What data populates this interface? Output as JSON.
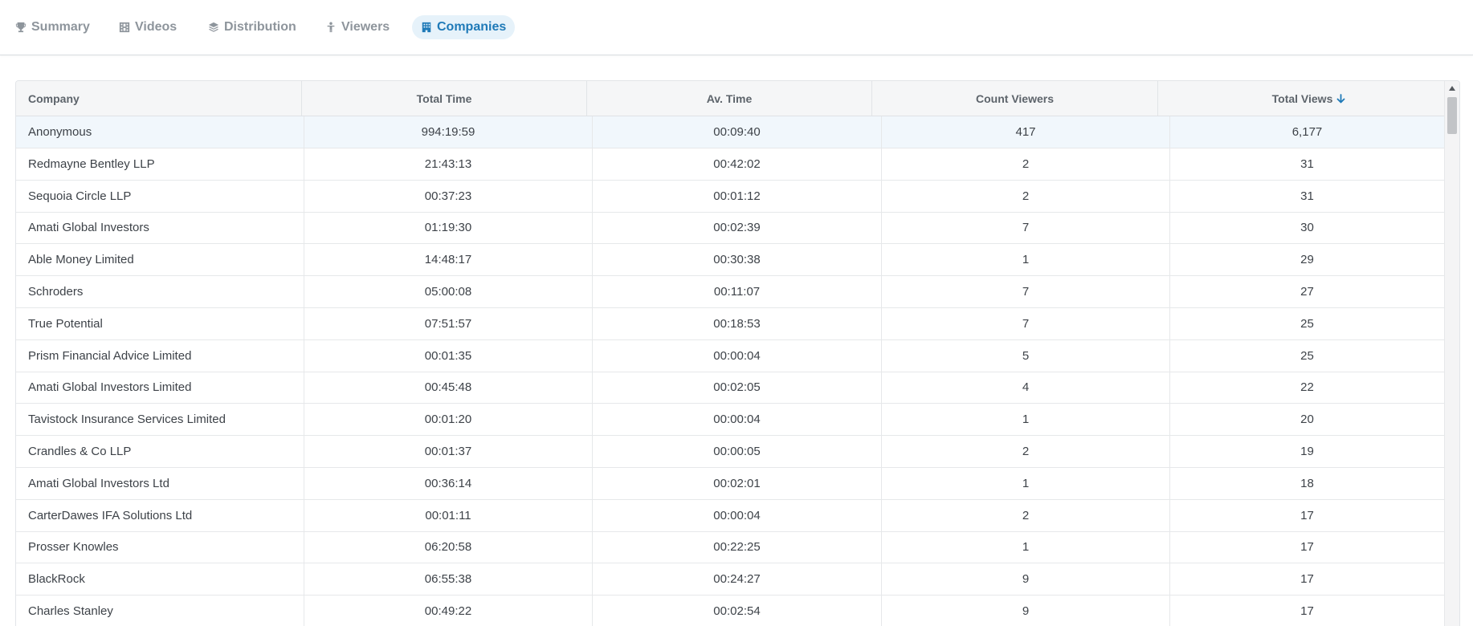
{
  "tabs": [
    {
      "label": "Summary",
      "icon": "trophy-icon",
      "active": false
    },
    {
      "label": "Videos",
      "icon": "film-icon",
      "active": false
    },
    {
      "label": "Distribution",
      "icon": "layers-icon",
      "active": false
    },
    {
      "label": "Viewers",
      "icon": "person-icon",
      "active": false
    },
    {
      "label": "Companies",
      "icon": "building-icon",
      "active": true
    }
  ],
  "table": {
    "columns": [
      {
        "label": "Company"
      },
      {
        "label": "Total Time"
      },
      {
        "label": "Av. Time"
      },
      {
        "label": "Count Viewers"
      },
      {
        "label": "Total Views",
        "sorted": "descending"
      }
    ],
    "rows": [
      {
        "company": "Anonymous",
        "total_time": "994:19:59",
        "av_time": "00:09:40",
        "count_viewers": "417",
        "total_views": "6,177"
      },
      {
        "company": "Redmayne Bentley LLP",
        "total_time": "21:43:13",
        "av_time": "00:42:02",
        "count_viewers": "2",
        "total_views": "31"
      },
      {
        "company": "Sequoia Circle LLP",
        "total_time": "00:37:23",
        "av_time": "00:01:12",
        "count_viewers": "2",
        "total_views": "31"
      },
      {
        "company": "Amati Global Investors",
        "total_time": "01:19:30",
        "av_time": "00:02:39",
        "count_viewers": "7",
        "total_views": "30"
      },
      {
        "company": "Able Money Limited",
        "total_time": "14:48:17",
        "av_time": "00:30:38",
        "count_viewers": "1",
        "total_views": "29"
      },
      {
        "company": "Schroders",
        "total_time": "05:00:08",
        "av_time": "00:11:07",
        "count_viewers": "7",
        "total_views": "27"
      },
      {
        "company": "True Potential",
        "total_time": "07:51:57",
        "av_time": "00:18:53",
        "count_viewers": "7",
        "total_views": "25"
      },
      {
        "company": "Prism Financial Advice Limited",
        "total_time": "00:01:35",
        "av_time": "00:00:04",
        "count_viewers": "5",
        "total_views": "25"
      },
      {
        "company": "Amati Global Investors Limited",
        "total_time": "00:45:48",
        "av_time": "00:02:05",
        "count_viewers": "4",
        "total_views": "22"
      },
      {
        "company": "Tavistock Insurance Services Limited",
        "total_time": "00:01:20",
        "av_time": "00:00:04",
        "count_viewers": "1",
        "total_views": "20"
      },
      {
        "company": "Crandles & Co LLP",
        "total_time": "00:01:37",
        "av_time": "00:00:05",
        "count_viewers": "2",
        "total_views": "19"
      },
      {
        "company": "Amati Global Investors Ltd",
        "total_time": "00:36:14",
        "av_time": "00:02:01",
        "count_viewers": "1",
        "total_views": "18"
      },
      {
        "company": "CarterDawes IFA Solutions Ltd",
        "total_time": "00:01:11",
        "av_time": "00:00:04",
        "count_viewers": "2",
        "total_views": "17"
      },
      {
        "company": "Prosser Knowles",
        "total_time": "06:20:58",
        "av_time": "00:22:25",
        "count_viewers": "1",
        "total_views": "17"
      },
      {
        "company": "BlackRock",
        "total_time": "06:55:38",
        "av_time": "00:24:27",
        "count_viewers": "9",
        "total_views": "17"
      },
      {
        "company": "Charles Stanley",
        "total_time": "00:49:22",
        "av_time": "00:02:54",
        "count_viewers": "9",
        "total_views": "17"
      }
    ]
  },
  "colors": {
    "accent": "#1f7ab8",
    "active_tab_bg": "#e6f2fa",
    "inactive_tab": "#8e959c",
    "highlight_row": "#f1f7fc"
  }
}
